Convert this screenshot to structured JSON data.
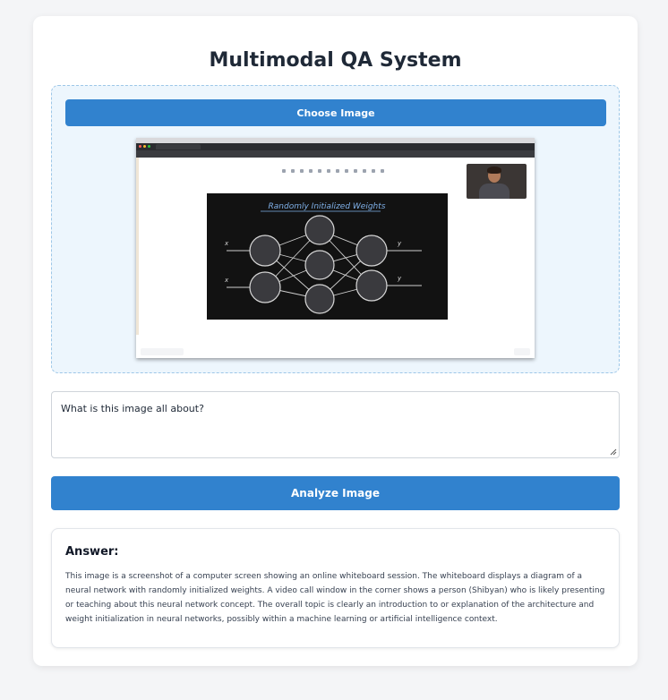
{
  "app": {
    "title": "Multimodal QA System"
  },
  "upload": {
    "choose_label": "Choose Image",
    "preview_board_title": "Randomly Initialized Weights"
  },
  "question": {
    "value": "What is this image all about?"
  },
  "analyze_label": "Analyze Image",
  "answer": {
    "heading": "Answer:",
    "text": "This image is a screenshot of a computer screen showing an online whiteboard session. The whiteboard displays a diagram of a neural network with randomly initialized weights. A video call window in the corner shows a person (Shibyan) who is likely presenting or teaching about this neural network concept. The overall topic is clearly an introduction to or explanation of the architecture and weight initialization in neural networks, possibly within a machine learning or artificial intelligence context."
  },
  "colors": {
    "accent": "#3182ce",
    "upload_bg": "#edf6fd",
    "page_bg": "#f4f5f7"
  }
}
